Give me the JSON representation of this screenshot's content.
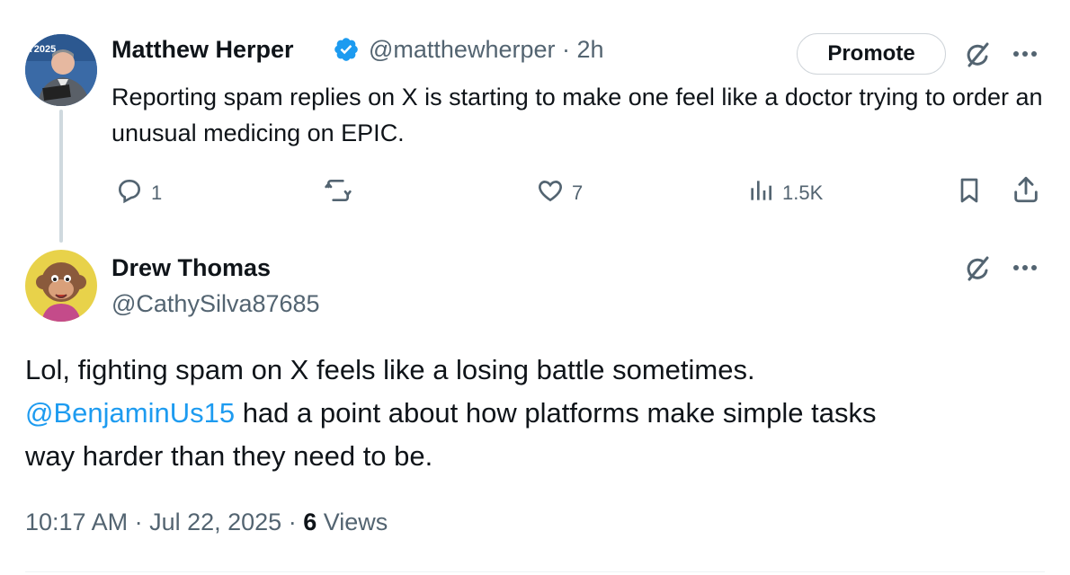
{
  "original_tweet": {
    "author_name": "Matthew Herper",
    "handle_time": "@matthewherper · 2h",
    "text": "Reporting spam replies on X is starting to make one feel like a doctor trying to order an unusual medicing on EPIC.",
    "promote_label": "Promote",
    "avatar_badge_text": "T2025",
    "stats": {
      "replies": "1",
      "likes": "7",
      "views": "1.5K"
    }
  },
  "reply_tweet": {
    "author_name": "Drew Thomas",
    "handle": "@CathySilva87685",
    "text_line1": "Lol, fighting spam on X feels like a losing battle sometimes.",
    "mention": "@BenjaminUs15",
    "text_line2_rest": " had a point about how platforms make simple tasks",
    "text_line3": "way harder than they need to be.",
    "timestamp": "10:17 AM · Jul 22, 2025 · ",
    "view_count": "6",
    "views_label": " Views"
  },
  "colors": {
    "verified": "#1d9bf0",
    "link": "#1d9bf0",
    "muted": "#536471",
    "thread_line": "#cfd9de"
  },
  "icons": [
    "verified-badge-icon",
    "grok-icon",
    "more-icon",
    "reply-icon",
    "retweet-icon",
    "like-icon",
    "views-icon",
    "bookmark-icon",
    "share-icon"
  ]
}
